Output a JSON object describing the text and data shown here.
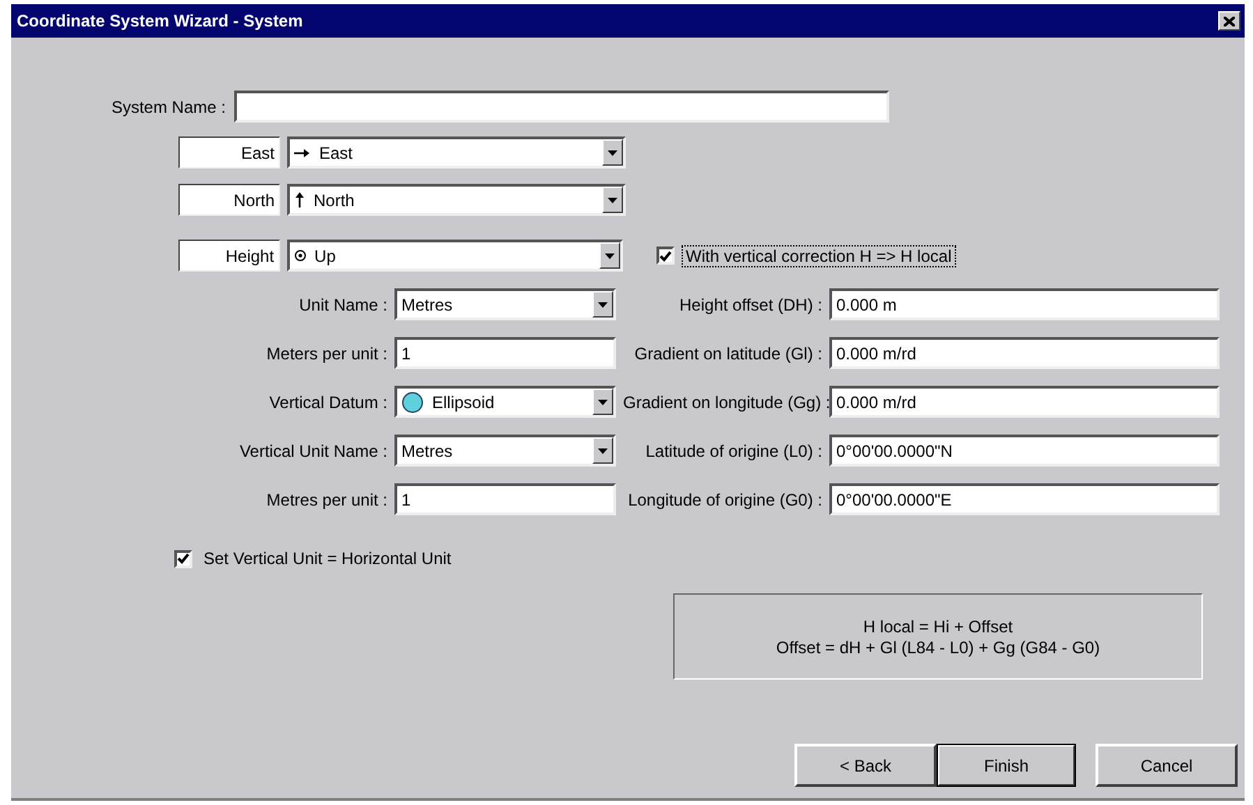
{
  "window": {
    "title": "Coordinate System Wizard - System"
  },
  "system_name": {
    "label": "System Name :"
  },
  "axes": [
    {
      "name": "East",
      "direction": "East",
      "kind": "right"
    },
    {
      "name": "North",
      "direction": "North",
      "kind": "up"
    },
    {
      "name": "Height",
      "direction": "Up",
      "kind": "dot"
    }
  ],
  "vertical_correction": {
    "label": "With vertical correction H => H local",
    "checked": true
  },
  "left_fields": [
    {
      "kind": "combo",
      "label": "Unit Name :",
      "value": "Metres"
    },
    {
      "kind": "text",
      "label": "Meters per unit :",
      "value": "1"
    },
    {
      "kind": "datum",
      "label": "Vertical Datum :",
      "value": "Ellipsoid"
    },
    {
      "kind": "combo",
      "label": "Vertical Unit Name :",
      "value": "Metres"
    },
    {
      "kind": "text",
      "label": "Metres per unit :",
      "value": "1"
    }
  ],
  "right_fields": [
    {
      "label": "Height offset (DH) :",
      "value": "0.000 m"
    },
    {
      "label": "Gradient on latitude (Gl) :",
      "value": "0.000 m/rd"
    },
    {
      "label": "Gradient on longitude (Gg) :",
      "value": "0.000 m/rd"
    },
    {
      "label": "Latitude of origine (L0) :",
      "value": "0°00'00.0000\"N"
    },
    {
      "label": "Longitude of origine (G0) :",
      "value": "0°00'00.0000\"E"
    }
  ],
  "set_vertical_unit": {
    "label": "Set Vertical Unit = Horizontal Unit",
    "checked": true
  },
  "formula": [
    "H local = Hi + Offset",
    "Offset = dH + Gl (L84 - L0) + Gg (G84 - G0)"
  ],
  "buttons": [
    {
      "label": "< Back",
      "kind": "normal"
    },
    {
      "label": "Finish",
      "kind": "default"
    },
    {
      "label": "Cancel",
      "kind": "normal"
    }
  ]
}
